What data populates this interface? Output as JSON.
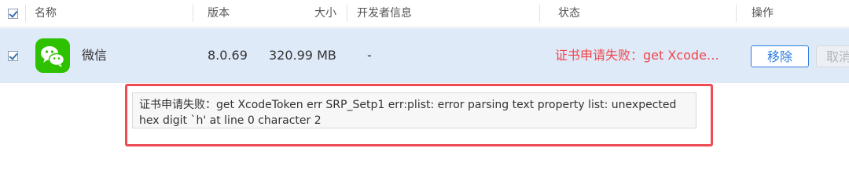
{
  "header": {
    "col_name": "名称",
    "col_version": "版本",
    "col_size": "大小",
    "col_developer": "开发者信息",
    "col_status": "状态",
    "col_actions": "操作"
  },
  "app": {
    "name": "微信",
    "icon": "wechat-icon",
    "version": "8.0.69",
    "size": "320.99 MB",
    "developer": "-",
    "status": "证书申请失败：get Xcode…"
  },
  "actions": {
    "remove_label": "移除",
    "cancel_label": "取消"
  },
  "tooltip": {
    "message": "证书申请失败：get XcodeToken err SRP_Setp1 err:plist: error parsing text property list: unexpected hex digit `h' at line 0 character 2"
  },
  "colors": {
    "row_selected": "#dfeaf9",
    "status_error": "#f0454a",
    "primary": "#2f7de1",
    "highlight_outline": "#ef4b55",
    "wechat_green": "#2dc100"
  }
}
